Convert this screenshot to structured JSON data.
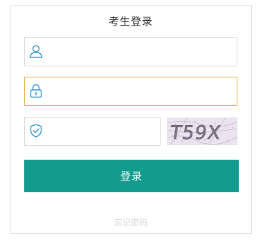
{
  "form": {
    "title": "考生登录",
    "username": {
      "value": "",
      "placeholder": "",
      "icon": "user-icon"
    },
    "password": {
      "value": "",
      "placeholder": "",
      "icon": "lock-icon"
    },
    "captcha": {
      "value": "",
      "placeholder": "",
      "icon": "shield-check-icon",
      "image_text": "T59X"
    },
    "login_label": "登录",
    "forgot_label": "忘记密码"
  },
  "colors": {
    "accent": "#119c8e",
    "icon": "#2f93c6",
    "focus_border": "#e6b34a",
    "border": "#d9d9d9"
  }
}
